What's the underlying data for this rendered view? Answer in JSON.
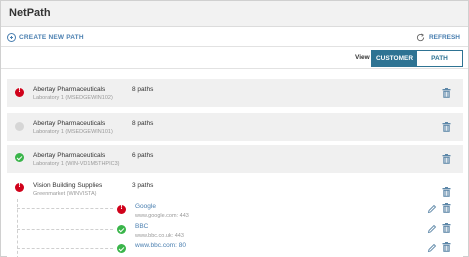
{
  "app": {
    "title": "NetPath"
  },
  "toolbar": {
    "create_label": "CREATE NEW PATH",
    "refresh_label": "REFRESH"
  },
  "view": {
    "label": "View",
    "customer_label": "CUSTOMER",
    "path_label": "PATH",
    "selected": "CUSTOMER"
  },
  "rows": [
    {
      "status": "critical",
      "name": "Abertay Pharmaceuticals",
      "sub": "Laboratory 1 (MSEDGEWIN102)",
      "paths": "8 paths"
    },
    {
      "status": "unknown",
      "name": "Abertay Pharmaceuticals",
      "sub": "Laboratory 1 (MSEDGEWIN101)",
      "paths": "8 paths"
    },
    {
      "status": "ok",
      "name": "Abertay Pharmaceuticals",
      "sub": "Laboratory 1 (WIN-VD1M5THPIC3)",
      "paths": "6 paths"
    },
    {
      "status": "critical",
      "name": "Vision Building Supplies",
      "sub": "Greenmarket (WINVISTA)",
      "paths": "3 paths",
      "children": [
        {
          "status": "critical",
          "name": "Google",
          "addr": "www.google.com: 443"
        },
        {
          "status": "ok",
          "name": "BBC",
          "addr": "www.bbc.co.uk: 443"
        },
        {
          "status": "ok",
          "name": "www.bbc.com: 80",
          "addr": ""
        }
      ]
    }
  ],
  "colors": {
    "accent": "#2e7393",
    "link": "#4a7fb0",
    "critical": "#d0021b",
    "ok": "#3ab54a",
    "unknown": "#d6d6d6"
  },
  "icons": {
    "create": "plus-circle-icon",
    "refresh": "refresh-icon",
    "delete": "trash-icon",
    "edit": "pencil-icon"
  }
}
